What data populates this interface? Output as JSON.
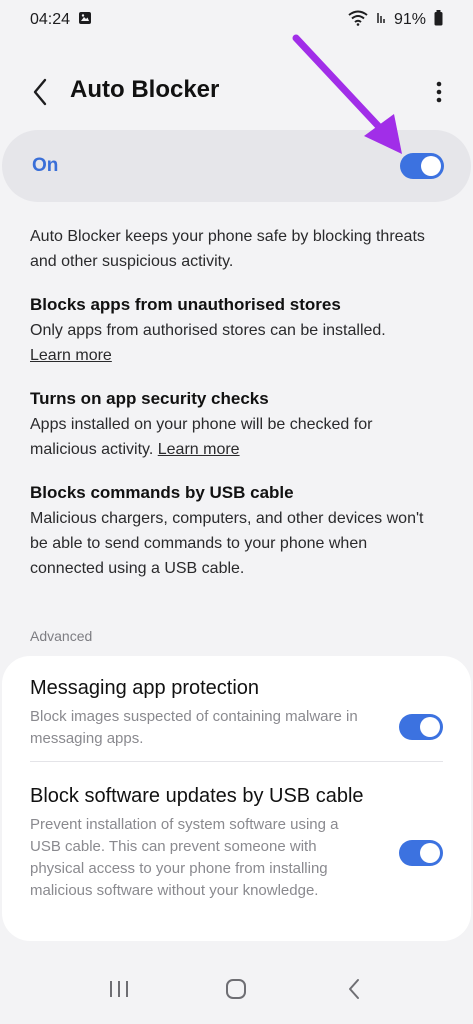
{
  "status_bar": {
    "time": "04:24",
    "battery": "91%"
  },
  "header": {
    "title": "Auto Blocker"
  },
  "master": {
    "label": "On",
    "enabled": true
  },
  "description": "Auto Blocker keeps your phone safe by blocking threats and other suspicious activity.",
  "sections": [
    {
      "title": "Blocks apps from unauthorised stores",
      "body": "Only apps from authorised stores can be installed.",
      "link": "Learn more"
    },
    {
      "title": "Turns on app security checks",
      "body": "Apps installed on your phone will be checked for malicious activity.",
      "link": "Learn more"
    },
    {
      "title": "Blocks commands by USB cable",
      "body": "Malicious chargers, computers, and other devices won't be able to send commands to your phone when connected using a USB cable."
    }
  ],
  "advanced": {
    "label": "Advanced",
    "items": [
      {
        "title": "Messaging app protection",
        "description": "Block images suspected of containing malware in messaging apps.",
        "enabled": true
      },
      {
        "title": "Block software updates by USB cable",
        "description": "Prevent installation of system software using a USB cable. This can prevent someone with physical access to your phone from installing malicious software without your knowledge.",
        "enabled": true
      }
    ]
  },
  "colors": {
    "accent": "#3c72e0",
    "annotation_arrow": "#a12ee8"
  },
  "icons": {
    "back": "chevron-left-icon",
    "more": "more-vert-icon",
    "nav_recents": "recents-icon",
    "nav_home": "home-icon",
    "nav_back": "back-icon"
  }
}
